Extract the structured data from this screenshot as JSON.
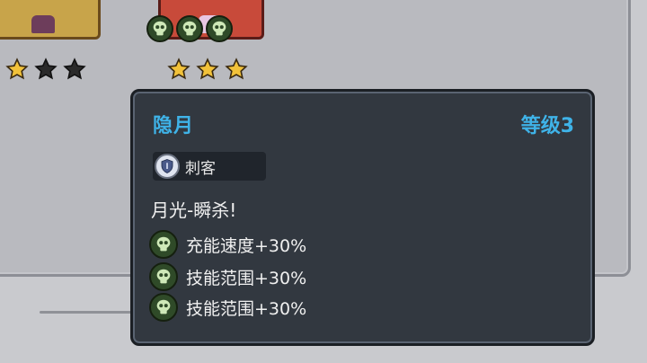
{
  "colors": {
    "title": "#3fb3e8",
    "panel": "#323840",
    "skull_badge": "#2f4a28",
    "star_gold": "#f2c23a",
    "star_empty": "#2a2a2a"
  },
  "background": {
    "left_card_stars": {
      "filled": 1,
      "total": 3
    },
    "right_card_stars": {
      "filled": 3,
      "total": 3
    },
    "right_card_skulls": 3
  },
  "tooltip": {
    "name": "隐月",
    "level": "等级3",
    "class_tag": {
      "icon": "shield-icon",
      "label": "刺客"
    },
    "skill": "月光-瞬杀!",
    "buffs": [
      {
        "icon": "skull-icon",
        "text": "充能速度+30%"
      },
      {
        "icon": "skull-icon",
        "text": "技能范围+30%"
      },
      {
        "icon": "skull-icon",
        "text": "技能范围+30%"
      }
    ]
  }
}
